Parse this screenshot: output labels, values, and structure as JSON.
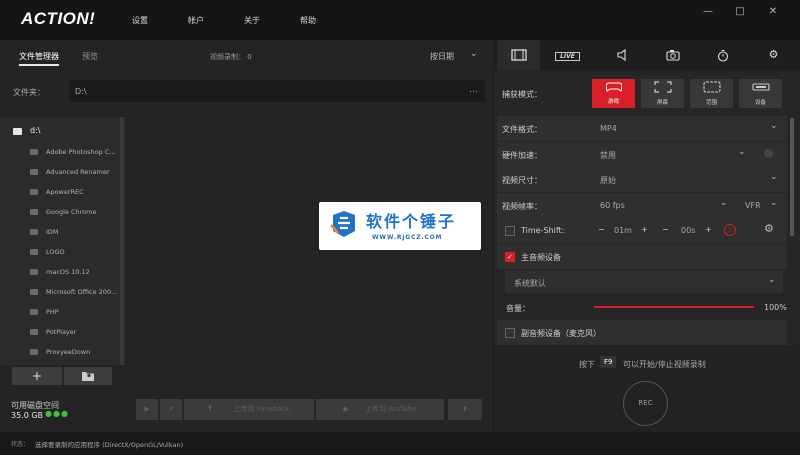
{
  "app": {
    "logo": "ACTION!"
  },
  "menu": [
    "设置",
    "帐户",
    "关于",
    "帮助"
  ],
  "window": {
    "minimize": "—",
    "maximize": "□",
    "close": "✕"
  },
  "left": {
    "tabs": [
      "文件管理器",
      "预览"
    ],
    "video_count_label": "视频录制：",
    "video_count": "0",
    "sort_label": "按日期",
    "folder_label": "文件夹：",
    "folder_path": "D:\\",
    "tree_root": "d:\\",
    "tree_items": [
      "Adobe Photoshop C...",
      "Advanced Renamer",
      "ApowerREC",
      "Google Chrome",
      "IDM",
      "LOGO",
      "macOS 10.12",
      "Microsoft Office 200...",
      "PHP",
      "PotPlayer",
      "ProxyeeDown"
    ],
    "add_button": "+",
    "disk_label": "可用磁盘空间",
    "disk_value": "35.0 GB",
    "disk_dots": "●●●",
    "action_buttons": [
      "▶",
      "✕",
      "上传到 Facebook",
      "上传到 YouTube",
      "⬆"
    ]
  },
  "watermark": {
    "title": "软件个锤子",
    "url": "WWW.RJGCZ.COM"
  },
  "right": {
    "tabs": [
      "video-icon",
      "live-icon",
      "audio-icon",
      "camera-icon",
      "timer-icon",
      "gear-icon"
    ],
    "live_label": "LIVE",
    "capture_mode_label": "捕获模式：",
    "modes": [
      {
        "label": "游戏",
        "icon": "gamepad-icon"
      },
      {
        "label": "屏幕",
        "icon": "screen-icon"
      },
      {
        "label": "范围",
        "icon": "region-icon"
      },
      {
        "label": "设备",
        "icon": "device-icon"
      }
    ],
    "file_format_label": "文件格式：",
    "file_format": "MP4",
    "hw_accel_label": "硬件加速：",
    "hw_accel": "禁用",
    "video_size_label": "视频尺寸：",
    "video_size": "原始",
    "frame_rate_label": "视频帧率：",
    "frame_rate": "60 fps",
    "frame_mode": "VFR",
    "timeshift_label": "Time-Shift:",
    "timeshift_minutes": "01m",
    "timeshift_seconds": "00s",
    "main_audio_label": "主音频设备",
    "main_audio_device": "系统默认",
    "volume_label": "音量：",
    "volume_percent": "100%",
    "volume_level": 1.0,
    "mic_label": "副音频设备（麦克风）",
    "hint_press": "按下",
    "hint_key": "F9",
    "hint_text": "可以开始/停止视频录制",
    "rec_label": "REC"
  },
  "status": {
    "label": "状态：",
    "text": "选择要录制的应用程序 (DirectX/OpenGL/Vulkan)"
  },
  "colors": {
    "accent": "#d81f2a",
    "bg": "#1c1c1c",
    "panel": "#262626"
  }
}
